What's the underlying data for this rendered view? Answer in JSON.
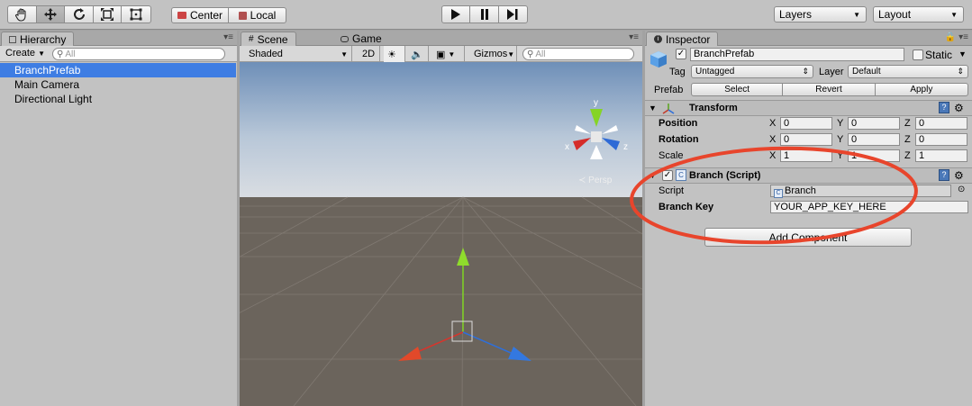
{
  "toolbar": {
    "transform_tools": [
      "hand-icon",
      "move-icon",
      "rotate-icon",
      "scale-icon",
      "rect-tool-icon"
    ],
    "pivot_center": "Center",
    "pivot_local": "Local",
    "play_controls": [
      "play-icon",
      "pause-icon",
      "step-icon"
    ],
    "layers": "Layers",
    "layout": "Layout"
  },
  "hierarchy": {
    "tab": "Hierarchy",
    "create": "Create",
    "search_placeholder": "All",
    "items": [
      {
        "label": "BranchPrefab",
        "selected": true
      },
      {
        "label": "Main Camera",
        "selected": false
      },
      {
        "label": "Directional Light",
        "selected": false
      }
    ]
  },
  "scene": {
    "tabs": [
      "Scene",
      "Game"
    ],
    "shading": "Shaded",
    "mode_2d": "2D",
    "gizmos": "Gizmos",
    "search_placeholder": "All",
    "persp": "Persp",
    "gizmo_axes": {
      "y": "y",
      "x": "x",
      "z": "z"
    }
  },
  "inspector": {
    "tab": "Inspector",
    "object_name": "BranchPrefab",
    "static_label": "Static",
    "tag_label": "Tag",
    "tag_value": "Untagged",
    "layer_label": "Layer",
    "layer_value": "Default",
    "prefab_label": "Prefab",
    "prefab_buttons": [
      "Select",
      "Revert",
      "Apply"
    ],
    "transform": {
      "title": "Transform",
      "rows": [
        {
          "label": "Position",
          "x": "0",
          "y": "0",
          "z": "0"
        },
        {
          "label": "Rotation",
          "x": "0",
          "y": "0",
          "z": "0"
        },
        {
          "label": "Scale",
          "x": "1",
          "y": "1",
          "z": "1"
        }
      ]
    },
    "script_component": {
      "title": "Branch (Script)",
      "script_label": "Script",
      "script_value": "Branch",
      "key_label": "Branch Key",
      "key_value": "YOUR_APP_KEY_HERE"
    },
    "add_component": "Add Component"
  },
  "colors": {
    "selection": "#3e7de3",
    "annotation": "#e8452c",
    "axis_x": "#d9342b",
    "axis_y": "#7ed321",
    "axis_z": "#2f6fd9"
  }
}
